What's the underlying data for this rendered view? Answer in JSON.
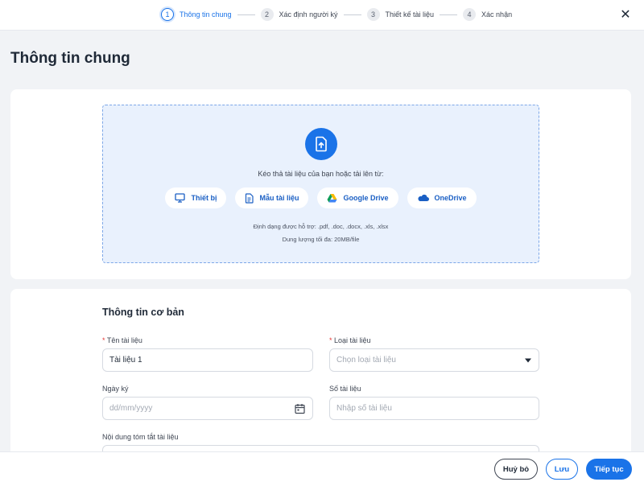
{
  "stepper": {
    "steps": [
      {
        "num": "1",
        "label": "Thông tin chung"
      },
      {
        "num": "2",
        "label": "Xác định người ký"
      },
      {
        "num": "3",
        "label": "Thiết kế tài liệu"
      },
      {
        "num": "4",
        "label": "Xác nhận"
      }
    ],
    "close": "✕"
  },
  "page_title": "Thông tin chung",
  "upload": {
    "drop_text": "Kéo thả tài liệu của bạn hoặc tải lên từ:",
    "sources": [
      {
        "label": "Thiết bị",
        "icon": "monitor-icon"
      },
      {
        "label": "Mẫu tài liệu",
        "icon": "document-template-icon"
      },
      {
        "label": "Google Drive",
        "icon": "google-drive-icon"
      },
      {
        "label": "OneDrive",
        "icon": "onedrive-icon"
      }
    ],
    "formats_hint": "Định dạng được hỗ trợ: .pdf, .doc, .docx, .xls, .xlsx",
    "size_hint": "Dung lượng tối đa: 20MB/file"
  },
  "form": {
    "section_title": "Thông tin cơ bản",
    "required_mark": "*",
    "doc_name": {
      "label": "Tên tài liệu",
      "value": "Tài liệu 1"
    },
    "doc_type": {
      "label": "Loại tài liệu",
      "placeholder": "Chọn loại tài liệu"
    },
    "sign_date": {
      "label": "Ngày ký",
      "placeholder": "dd/mm/yyyy"
    },
    "doc_number": {
      "label": "Số tài liệu",
      "placeholder": "Nhập số tài liệu"
    },
    "summary": {
      "label": "Nội dung tóm tắt tài liệu"
    }
  },
  "actions": {
    "cancel": "Huỷ bỏ",
    "save": "Lưu",
    "next": "Tiếp tục"
  },
  "colors": {
    "primary": "#1a73e8",
    "dropzone_bg": "#e9f1fd",
    "page_bg": "#f1f3f6",
    "required": "#e53935"
  }
}
